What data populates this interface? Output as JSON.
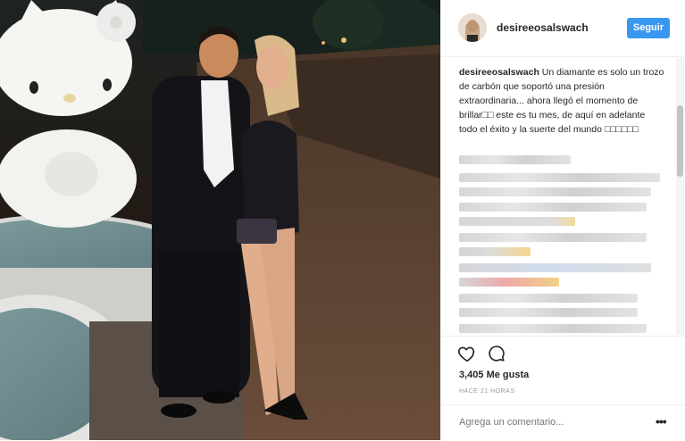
{
  "post": {
    "username": "desireeosalswach",
    "follow_label": "Seguir",
    "caption_user": "desireeosalswach",
    "caption_text": " Un diamante es solo un trozo de carbón que soportó una presión extraordinaria... ahora llegó el momento de brillar□□ este es tu mes, de aquí en adelante todo el éxito y la suerte del mundo □□□□□□",
    "likes": "3,405 Me gusta",
    "time": "HACE 21 HORAS",
    "comment_placeholder": "Agrega un comentario...",
    "more_label": "•••"
  },
  "icons": {
    "like": "heart-outline-icon",
    "comment": "speech-bubble-icon",
    "options": "three-dots-icon"
  },
  "colors": {
    "accent": "#3897f0",
    "text": "#262626",
    "muted": "#999999"
  }
}
